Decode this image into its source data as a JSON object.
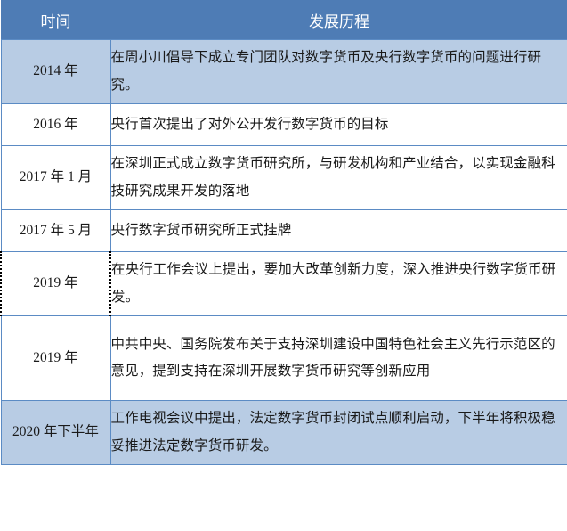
{
  "table": {
    "headers": {
      "time": "时间",
      "detail": "发展历程"
    },
    "rows": [
      {
        "time": "2014 年",
        "detail": "在周小川倡导下成立专门团队对数字货币及央行数字货币的问题进行研究。",
        "shaded": true,
        "height": "tall"
      },
      {
        "time": "2016 年",
        "detail": "央行首次提出了对外公开发行数字货币的目标",
        "shaded": false,
        "height": "short"
      },
      {
        "time": "2017 年 1 月",
        "detail": "在深圳正式成立数字货币研究所，与研发机构和产业结合，以实现金融科技研究成果开发的落地",
        "shaded": false,
        "height": "tall"
      },
      {
        "time": "2017 年 5 月",
        "detail": "央行数字货币研究所正式挂牌",
        "shaded": false,
        "height": "short"
      },
      {
        "time": "2019 年",
        "detail": "在央行工作会议上提出，要加大改革创新力度，深入推进央行数字货币研发。",
        "shaded": false,
        "height": "tall",
        "selected": true
      },
      {
        "time": "2019 年",
        "detail": "中共中央、国务院发布关于支持深圳建设中国特色社会主义先行示范区的意见，提到支持在深圳开展数字货币研究等创新应用",
        "shaded": false,
        "height": "xtall"
      },
      {
        "time": "2020 年下半年",
        "detail": "工作电视会议中提出，法定数字货币封闭试点顺利启动，下半年将积极稳妥推进法定数字货币研发。",
        "shaded": true,
        "height": "tall"
      }
    ]
  },
  "colors": {
    "header_bg": "#4E7CB5",
    "header_text": "#FFFFFF",
    "shaded_row_bg": "#B8CCE4",
    "plain_row_bg": "#FFFFFF",
    "border": "#5B8BC4",
    "body_text": "#1A1A1A"
  }
}
